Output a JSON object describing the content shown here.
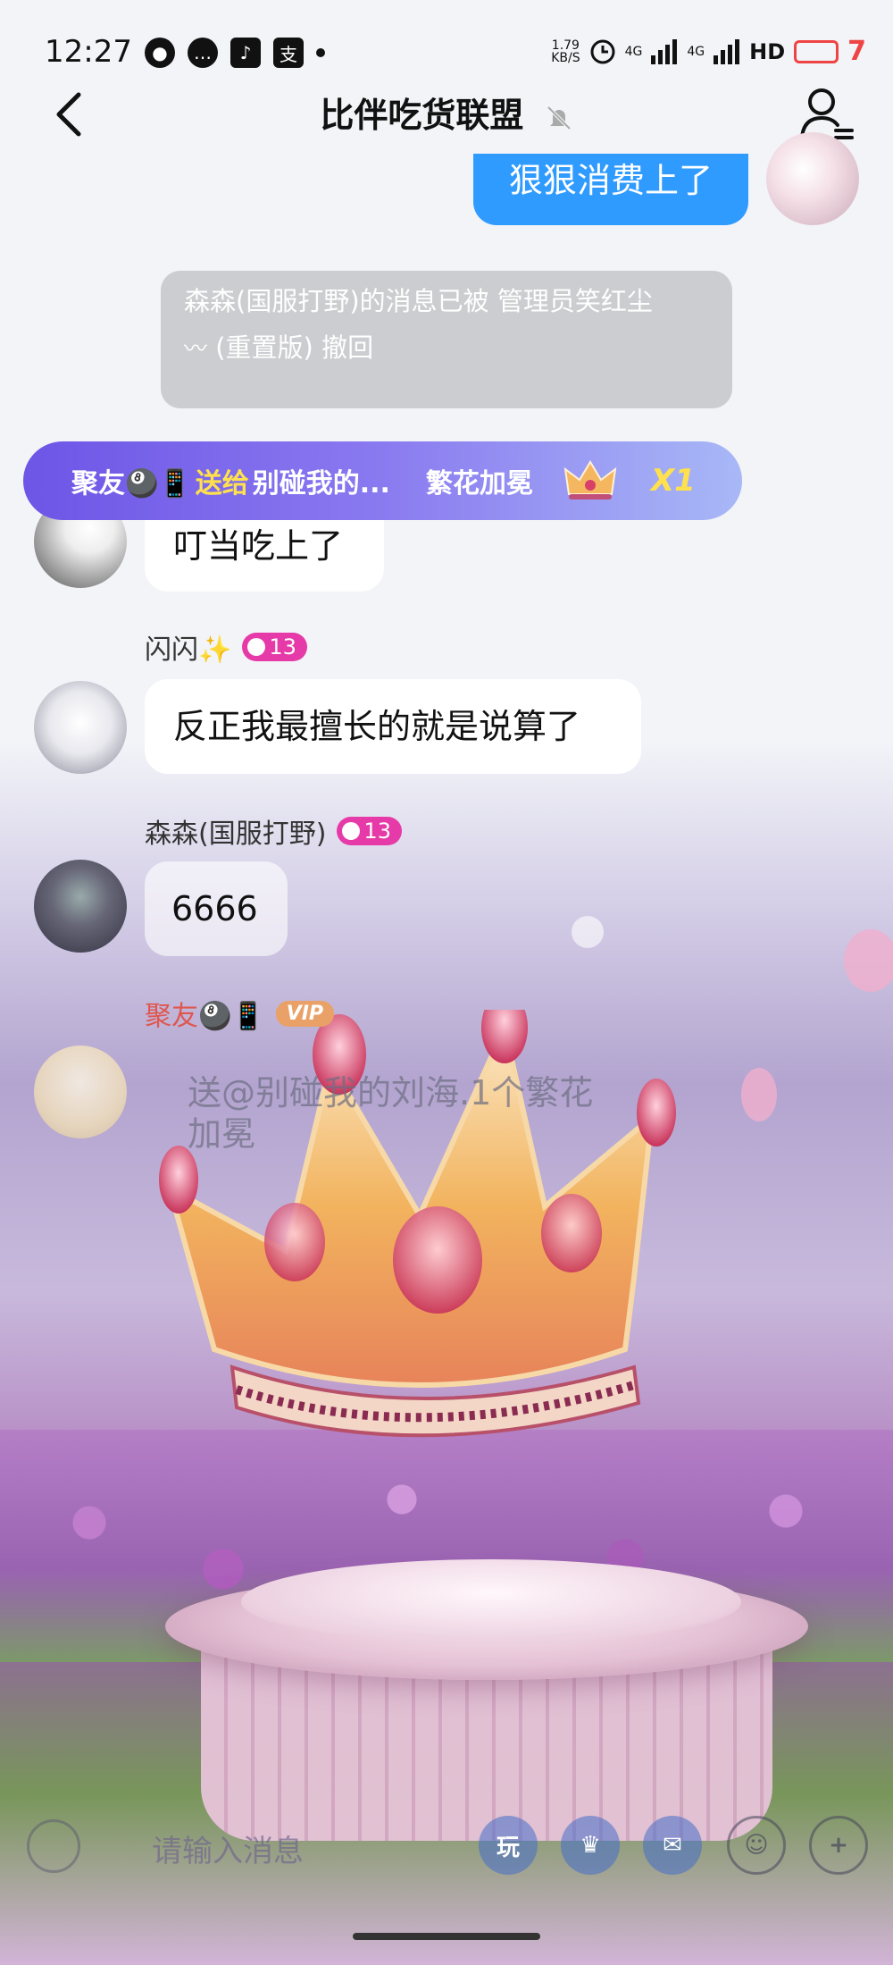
{
  "status_bar": {
    "time": "12:27",
    "net_speed_value": "1.79",
    "net_speed_unit": "KB/S",
    "network_labels": [
      "4G",
      "4G"
    ],
    "hd_label": "HD",
    "battery_level": "7",
    "icons": [
      "chat-bubble-icon",
      "message-icon",
      "tiktok-icon",
      "alipay-icon",
      "dot-icon"
    ]
  },
  "header": {
    "title": "比伴吃货联盟",
    "muted": true
  },
  "messages": {
    "own_message": "狠狠消费上了",
    "system_notice": "森森(国服打野)的消息已被 管理员笑红尘",
    "system_notice_line2": "(重置版)  撤回",
    "m1_text": "叮当吃上了",
    "m2_nick": "闪闪✨",
    "m2_level": "13",
    "m2_text": "反正我最擅长的就是说算了",
    "m3_nick": "森森(国服打野)",
    "m3_level": "13",
    "m3_text": "6666",
    "m4_nick": "聚友🎱📱",
    "m4_vip": "VIP",
    "m4_text": "送@别碰我的刘海.1个繁花加冕"
  },
  "gift_banner": {
    "sender": "聚友🎱📱",
    "verb": "送给",
    "recipient": "别碰我的...",
    "gift_name": "繁花加冕",
    "count": "X1"
  },
  "input_bar": {
    "placeholder": "请输入消息"
  },
  "colors": {
    "own_bubble": "#2f9bff",
    "level_badge": "#e53aa7",
    "vip_badge": "#e9a168",
    "banner_start": "#6d55e6",
    "banner_highlight": "#ffe14d"
  }
}
